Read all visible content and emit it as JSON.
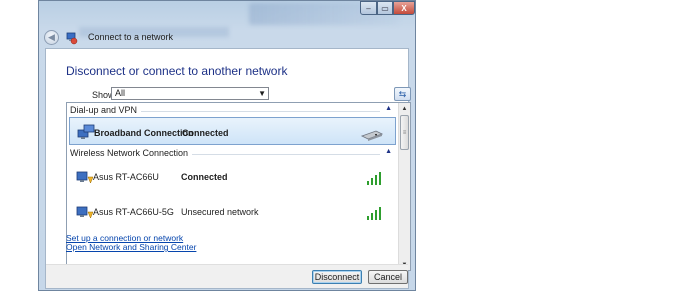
{
  "window": {
    "title": "Connect to a network",
    "controls": {
      "minimize": "–",
      "maximize": "▭",
      "close": "X"
    }
  },
  "main": {
    "heading": "Disconnect or connect to another network",
    "show_label": "Show",
    "show_value": "All"
  },
  "groups": [
    {
      "label": "Dial-up and VPN",
      "networks": [
        {
          "name": "Broadband Connection",
          "status": "Connected",
          "icon": "broadband-icon",
          "indicator": "modem-icon",
          "selected": true
        }
      ]
    },
    {
      "label": "Wireless Network Connection",
      "networks": [
        {
          "name": "Asus RT-AC66U",
          "status": "Connected",
          "icon": "wireless-network-icon",
          "indicator": "signal-strength-icon",
          "selected": false
        },
        {
          "name": "Asus RT-AC66U-5G",
          "status": "Unsecured network",
          "icon": "wireless-network-icon",
          "indicator": "signal-strength-icon",
          "selected": false
        }
      ]
    }
  ],
  "links": {
    "setup": "Set up a connection or network",
    "sharing_center": "Open Network and Sharing Center"
  },
  "buttons": {
    "disconnect": "Disconnect",
    "cancel": "Cancel"
  },
  "colors": {
    "heading": "#1e3287",
    "link": "#0645ad",
    "selection": "#cfe4f8",
    "signal": "#2e9e2e"
  }
}
